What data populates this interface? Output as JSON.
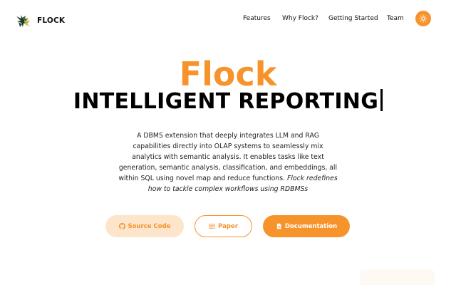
{
  "brand": {
    "name": "FLOCK",
    "logo_icon": "flock-birds-logo-icon"
  },
  "nav": {
    "items": [
      {
        "label": "Features"
      },
      {
        "label": "Why Flock?"
      },
      {
        "label": "Getting Started"
      },
      {
        "label": "Team"
      }
    ],
    "theme_toggle_icon": "sun-icon"
  },
  "hero": {
    "title": "Flock",
    "subtitle": "INTELLIGENT REPORTING",
    "description": "A DBMS extension that deeply integrates LLM and RAG capabilities directly into OLAP systems to seamlessly mix analytics with semantic analysis. It enables tasks like text generation, semantic analysis, classification, and embeddings, all within SQL using novel map and reduce functions.",
    "description_emphasis": "Flock redefines how to tackle complex workflows using RDBMSs"
  },
  "buttons": {
    "source_code": {
      "label": "Source Code",
      "icon": "github-icon"
    },
    "paper": {
      "label": "Paper",
      "icon": "newspaper-icon"
    },
    "documentation": {
      "label": "Documentation",
      "icon": "document-icon"
    }
  },
  "colors": {
    "accent": "#f7932b",
    "accent_soft": "#fde5cc",
    "text": "#111111",
    "background": "#ffffff"
  }
}
